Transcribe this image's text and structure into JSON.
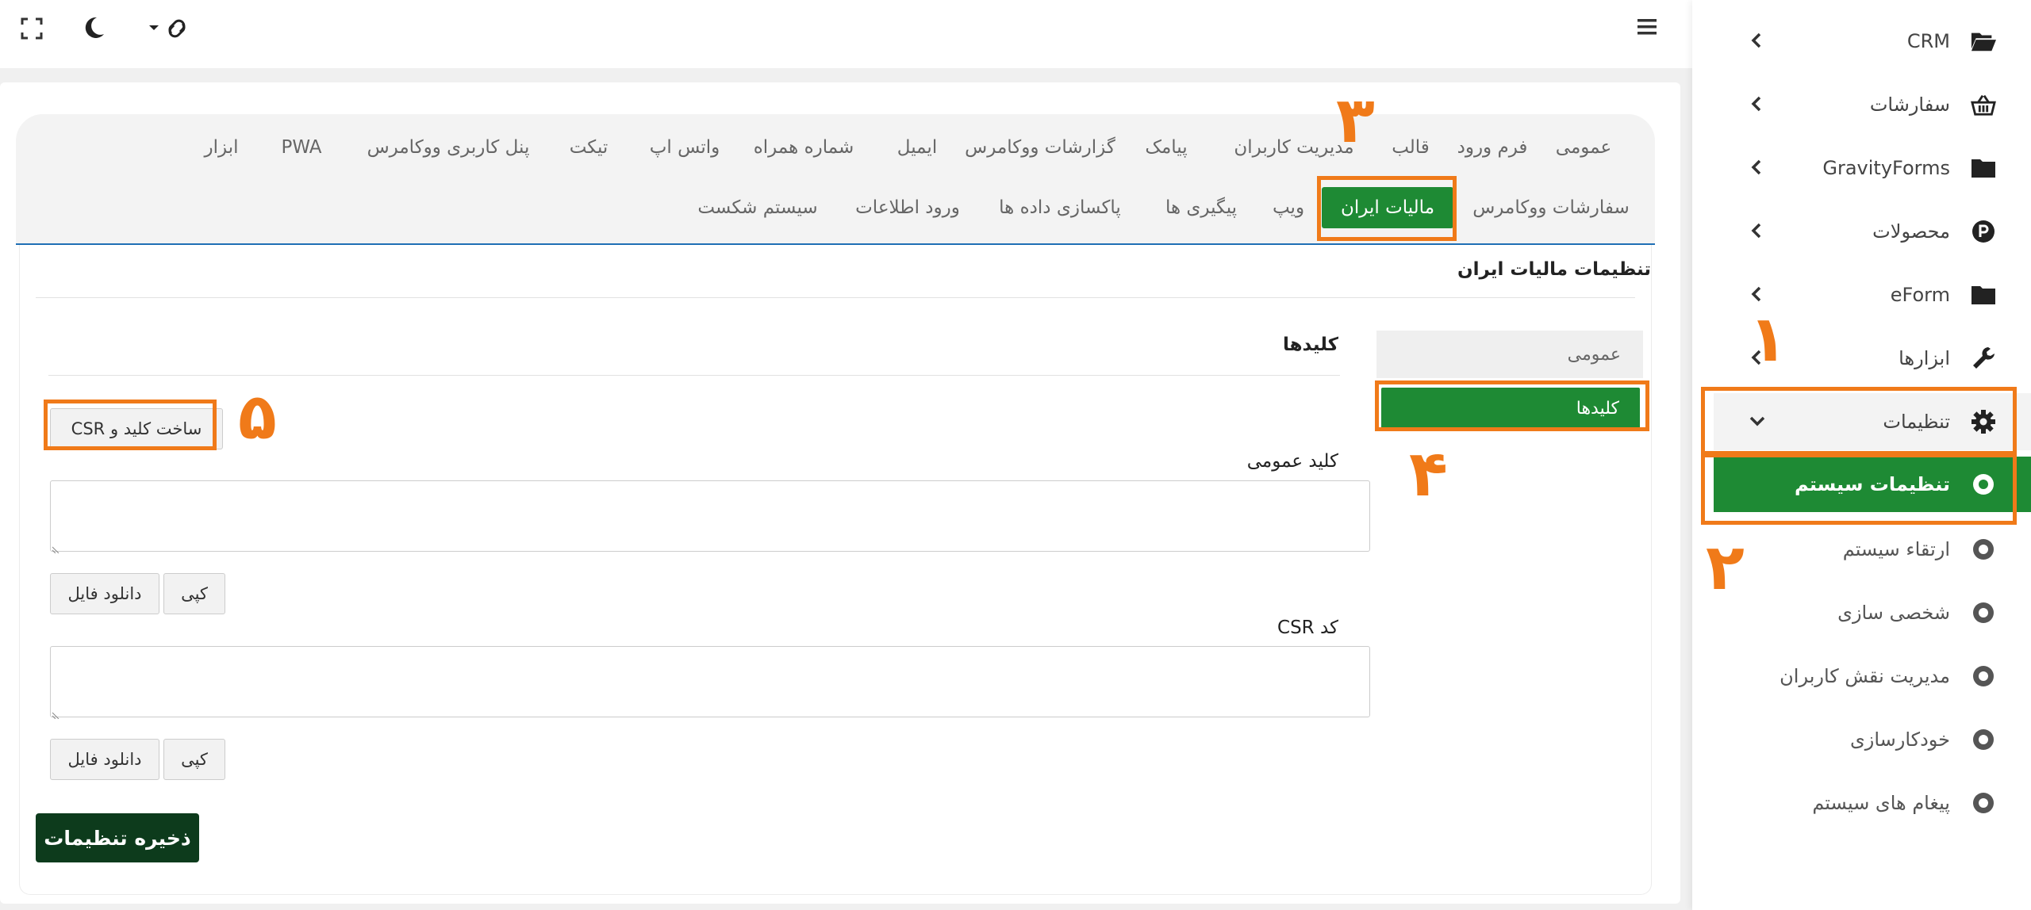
{
  "sidebar": {
    "items": [
      {
        "label": "CRM",
        "icon": "folder-open-icon"
      },
      {
        "label": "سفارشات",
        "icon": "basket-icon"
      },
      {
        "label": "GravityForms",
        "icon": "folder-icon"
      },
      {
        "label": "محصولات",
        "icon": "product-p-icon"
      },
      {
        "label": "eForm",
        "icon": "folder-icon"
      },
      {
        "label": "ابزارها",
        "icon": "wrench-icon"
      },
      {
        "label": "تنظیمات",
        "icon": "gear-icon"
      }
    ],
    "sub_items": [
      {
        "label": "تنظیمات سیستم",
        "active": true
      },
      {
        "label": "ارتقاء سیستم"
      },
      {
        "label": "شخصی سازی"
      },
      {
        "label": "مدیریت نقش کاربران"
      },
      {
        "label": "خودکارسازی"
      },
      {
        "label": "پیغام های سیستم"
      }
    ]
  },
  "tabs_row1": [
    "عمومی",
    "فرم ورود",
    "قالب",
    "مدیریت کاربران",
    "پیامک",
    "گزارشات ووکامرس",
    "ایمیل",
    "شماره همراه",
    "واتس اپ",
    "تیکت",
    "پنل کاربری ووکامرس",
    "PWA",
    "ابزار"
  ],
  "tabs_row2": [
    "سفارشات ووکامرس",
    "مالیات ایران",
    "ویپ",
    "پیگیری ها",
    "پاکسازی داده ها",
    "ورود اطلاعات",
    "سیستم شکست"
  ],
  "active_tab": "مالیات ایران",
  "section_title": "تنظیمات مالیات ایران",
  "side_menu": [
    {
      "label": "عمومی"
    },
    {
      "label": "کلیدها",
      "active": true
    }
  ],
  "panel_title": "کلیدها",
  "generate_button": "ساخت کلید و CSR",
  "public_key_label": "کلید عمومی",
  "csr_label": "کد CSR",
  "copy_label": "کپی",
  "download_label": "دانلود فایل",
  "save_button": "ذخیره تنظیمات",
  "annotations": [
    "۱",
    "۲",
    "۳",
    "۴",
    "۵"
  ],
  "colors": {
    "accent_green": "#1e8a34",
    "annotation_orange": "#f07a19",
    "save_green": "#0d3b1c",
    "tab_border_blue": "#1f6fb5"
  }
}
